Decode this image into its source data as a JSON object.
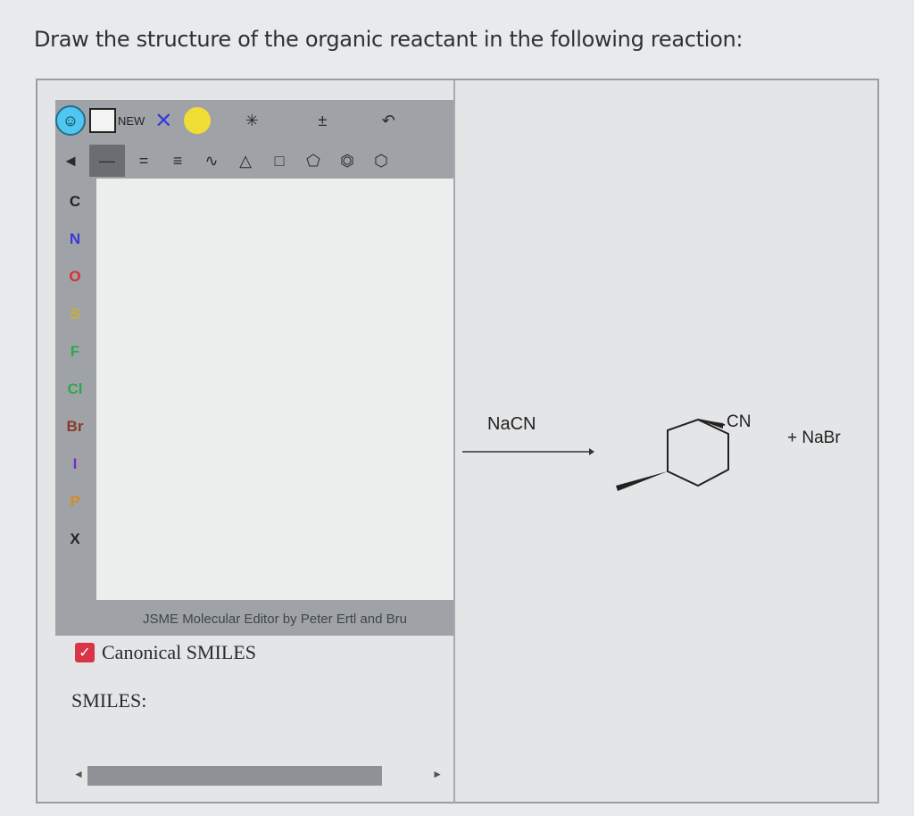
{
  "question": "Draw the structure of the organic reactant in the following reaction:",
  "toolbar": {
    "new_label": "NEW",
    "row1_icons": [
      "smile-icon",
      "new-canvas-icon",
      "delete-x-icon",
      "charge-dot-icon",
      "r-group-icon",
      "charge-icon",
      "undo-icon"
    ],
    "row2_icons": [
      "wedge-bond-icon",
      "single-bond-icon",
      "double-bond-icon",
      "triple-bond-icon",
      "chain-icon",
      "triangle-ring-icon",
      "square-ring-icon",
      "pentagon-ring-icon",
      "benzene-ring-icon",
      "hexagon-ring-icon"
    ]
  },
  "atoms": [
    {
      "label": "C",
      "color": "#222222"
    },
    {
      "label": "N",
      "color": "#3a3adb"
    },
    {
      "label": "O",
      "color": "#d83030"
    },
    {
      "label": "S",
      "color": "#c9b12a"
    },
    {
      "label": "F",
      "color": "#2ea84a"
    },
    {
      "label": "Cl",
      "color": "#2ea84a"
    },
    {
      "label": "Br",
      "color": "#8a3a2a"
    },
    {
      "label": "I",
      "color": "#7a2ac8"
    },
    {
      "label": "P",
      "color": "#d88a20"
    },
    {
      "label": "X",
      "color": "#222222"
    }
  ],
  "footer": "JSME Molecular Editor by Peter Ertl and Bru",
  "canonical_label": "Canonical SMILES",
  "smiles_label": "SMILES:",
  "reaction": {
    "reagent": "NaCN",
    "product_group": "CN",
    "byproduct": "+ NaBr"
  },
  "colors": {
    "accent": "#4ec8f0",
    "checkbox": "#d8344a"
  }
}
